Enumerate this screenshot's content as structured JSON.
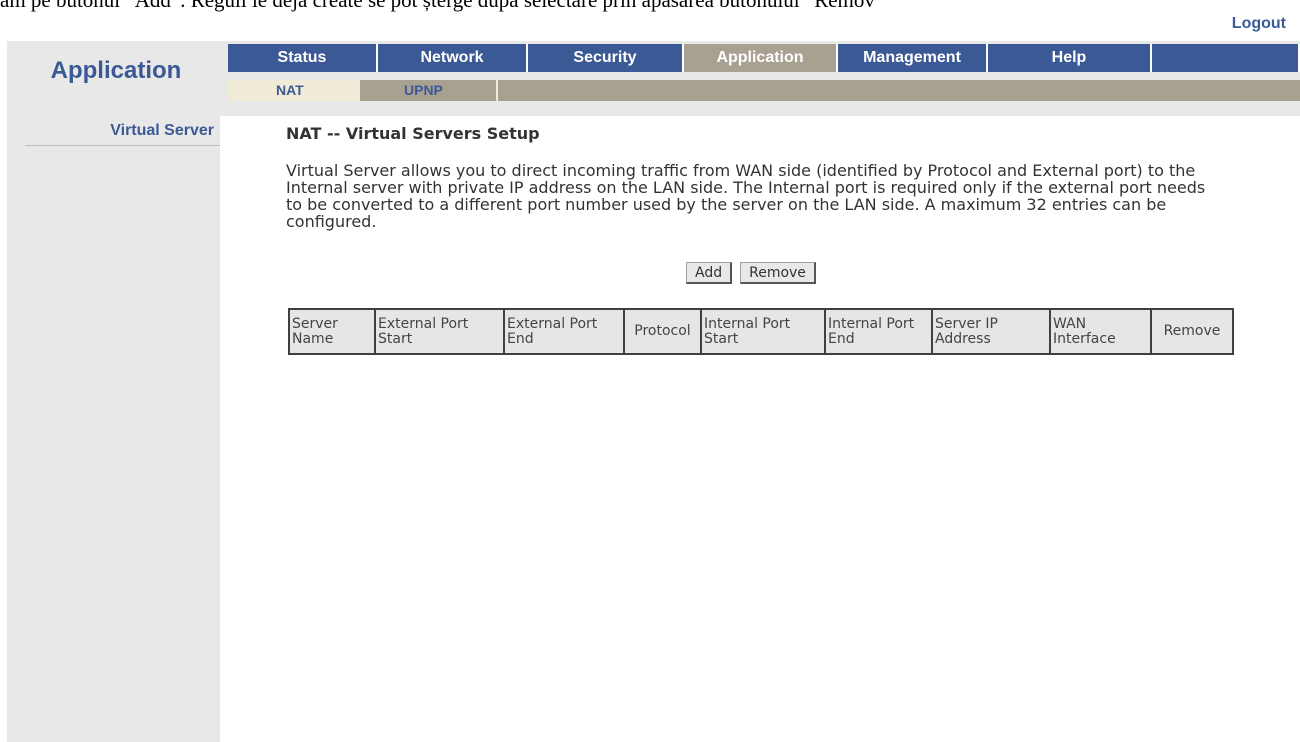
{
  "caption": "ăm pe butonul “Add”. Reguli le deja create se pot șterge după selectare prin apăsarea butonului “Remov",
  "header": {
    "logout": "Logout",
    "app_title": "Application"
  },
  "main_nav": [
    {
      "label": "Status"
    },
    {
      "label": "Network"
    },
    {
      "label": "Security"
    },
    {
      "label": "Application",
      "active": true
    },
    {
      "label": "Management"
    },
    {
      "label": "Help"
    }
  ],
  "sub_nav": [
    {
      "label": "NAT",
      "active": true
    },
    {
      "label": "UPNP"
    }
  ],
  "sidebar": {
    "items": [
      {
        "label": "Virtual Server"
      }
    ]
  },
  "main": {
    "title": "NAT -- Virtual Servers Setup",
    "description": "Virtual Server allows you to direct incoming traffic from WAN side (identified by Protocol and External port) to the Internal server with private IP address on the LAN side. The Internal port is required only if the external port needs to be converted to a different port number used by the server on the LAN side. A maximum 32 entries can be configured.",
    "add_label": "Add",
    "remove_label": "Remove",
    "table": {
      "columns": [
        "Server Name",
        "External Port Start",
        "External Port End",
        "Protocol",
        "Internal Port Start",
        "Internal Port End",
        "Server IP Address",
        "WAN Interface",
        "Remove"
      ],
      "rows": []
    }
  },
  "colors": {
    "nav_blue": "#3b5a95",
    "nav_active": "#a8a090",
    "sub_active": "#f0ebd6",
    "panel_gray": "#e8e8e8"
  }
}
